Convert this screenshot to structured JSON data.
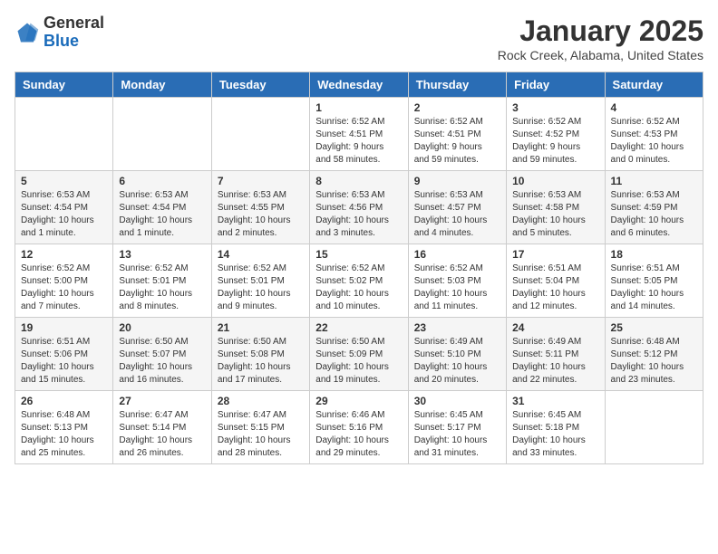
{
  "logo": {
    "general": "General",
    "blue": "Blue"
  },
  "title": {
    "month": "January 2025",
    "location": "Rock Creek, Alabama, United States"
  },
  "weekdays": [
    "Sunday",
    "Monday",
    "Tuesday",
    "Wednesday",
    "Thursday",
    "Friday",
    "Saturday"
  ],
  "weeks": [
    [
      {
        "day": "",
        "info": ""
      },
      {
        "day": "",
        "info": ""
      },
      {
        "day": "",
        "info": ""
      },
      {
        "day": "1",
        "info": "Sunrise: 6:52 AM\nSunset: 4:51 PM\nDaylight: 9 hours\nand 58 minutes."
      },
      {
        "day": "2",
        "info": "Sunrise: 6:52 AM\nSunset: 4:51 PM\nDaylight: 9 hours\nand 59 minutes."
      },
      {
        "day": "3",
        "info": "Sunrise: 6:52 AM\nSunset: 4:52 PM\nDaylight: 9 hours\nand 59 minutes."
      },
      {
        "day": "4",
        "info": "Sunrise: 6:52 AM\nSunset: 4:53 PM\nDaylight: 10 hours\nand 0 minutes."
      }
    ],
    [
      {
        "day": "5",
        "info": "Sunrise: 6:53 AM\nSunset: 4:54 PM\nDaylight: 10 hours\nand 1 minute."
      },
      {
        "day": "6",
        "info": "Sunrise: 6:53 AM\nSunset: 4:54 PM\nDaylight: 10 hours\nand 1 minute."
      },
      {
        "day": "7",
        "info": "Sunrise: 6:53 AM\nSunset: 4:55 PM\nDaylight: 10 hours\nand 2 minutes."
      },
      {
        "day": "8",
        "info": "Sunrise: 6:53 AM\nSunset: 4:56 PM\nDaylight: 10 hours\nand 3 minutes."
      },
      {
        "day": "9",
        "info": "Sunrise: 6:53 AM\nSunset: 4:57 PM\nDaylight: 10 hours\nand 4 minutes."
      },
      {
        "day": "10",
        "info": "Sunrise: 6:53 AM\nSunset: 4:58 PM\nDaylight: 10 hours\nand 5 minutes."
      },
      {
        "day": "11",
        "info": "Sunrise: 6:53 AM\nSunset: 4:59 PM\nDaylight: 10 hours\nand 6 minutes."
      }
    ],
    [
      {
        "day": "12",
        "info": "Sunrise: 6:52 AM\nSunset: 5:00 PM\nDaylight: 10 hours\nand 7 minutes."
      },
      {
        "day": "13",
        "info": "Sunrise: 6:52 AM\nSunset: 5:01 PM\nDaylight: 10 hours\nand 8 minutes."
      },
      {
        "day": "14",
        "info": "Sunrise: 6:52 AM\nSunset: 5:01 PM\nDaylight: 10 hours\nand 9 minutes."
      },
      {
        "day": "15",
        "info": "Sunrise: 6:52 AM\nSunset: 5:02 PM\nDaylight: 10 hours\nand 10 minutes."
      },
      {
        "day": "16",
        "info": "Sunrise: 6:52 AM\nSunset: 5:03 PM\nDaylight: 10 hours\nand 11 minutes."
      },
      {
        "day": "17",
        "info": "Sunrise: 6:51 AM\nSunset: 5:04 PM\nDaylight: 10 hours\nand 12 minutes."
      },
      {
        "day": "18",
        "info": "Sunrise: 6:51 AM\nSunset: 5:05 PM\nDaylight: 10 hours\nand 14 minutes."
      }
    ],
    [
      {
        "day": "19",
        "info": "Sunrise: 6:51 AM\nSunset: 5:06 PM\nDaylight: 10 hours\nand 15 minutes."
      },
      {
        "day": "20",
        "info": "Sunrise: 6:50 AM\nSunset: 5:07 PM\nDaylight: 10 hours\nand 16 minutes."
      },
      {
        "day": "21",
        "info": "Sunrise: 6:50 AM\nSunset: 5:08 PM\nDaylight: 10 hours\nand 17 minutes."
      },
      {
        "day": "22",
        "info": "Sunrise: 6:50 AM\nSunset: 5:09 PM\nDaylight: 10 hours\nand 19 minutes."
      },
      {
        "day": "23",
        "info": "Sunrise: 6:49 AM\nSunset: 5:10 PM\nDaylight: 10 hours\nand 20 minutes."
      },
      {
        "day": "24",
        "info": "Sunrise: 6:49 AM\nSunset: 5:11 PM\nDaylight: 10 hours\nand 22 minutes."
      },
      {
        "day": "25",
        "info": "Sunrise: 6:48 AM\nSunset: 5:12 PM\nDaylight: 10 hours\nand 23 minutes."
      }
    ],
    [
      {
        "day": "26",
        "info": "Sunrise: 6:48 AM\nSunset: 5:13 PM\nDaylight: 10 hours\nand 25 minutes."
      },
      {
        "day": "27",
        "info": "Sunrise: 6:47 AM\nSunset: 5:14 PM\nDaylight: 10 hours\nand 26 minutes."
      },
      {
        "day": "28",
        "info": "Sunrise: 6:47 AM\nSunset: 5:15 PM\nDaylight: 10 hours\nand 28 minutes."
      },
      {
        "day": "29",
        "info": "Sunrise: 6:46 AM\nSunset: 5:16 PM\nDaylight: 10 hours\nand 29 minutes."
      },
      {
        "day": "30",
        "info": "Sunrise: 6:45 AM\nSunset: 5:17 PM\nDaylight: 10 hours\nand 31 minutes."
      },
      {
        "day": "31",
        "info": "Sunrise: 6:45 AM\nSunset: 5:18 PM\nDaylight: 10 hours\nand 33 minutes."
      },
      {
        "day": "",
        "info": ""
      }
    ]
  ]
}
